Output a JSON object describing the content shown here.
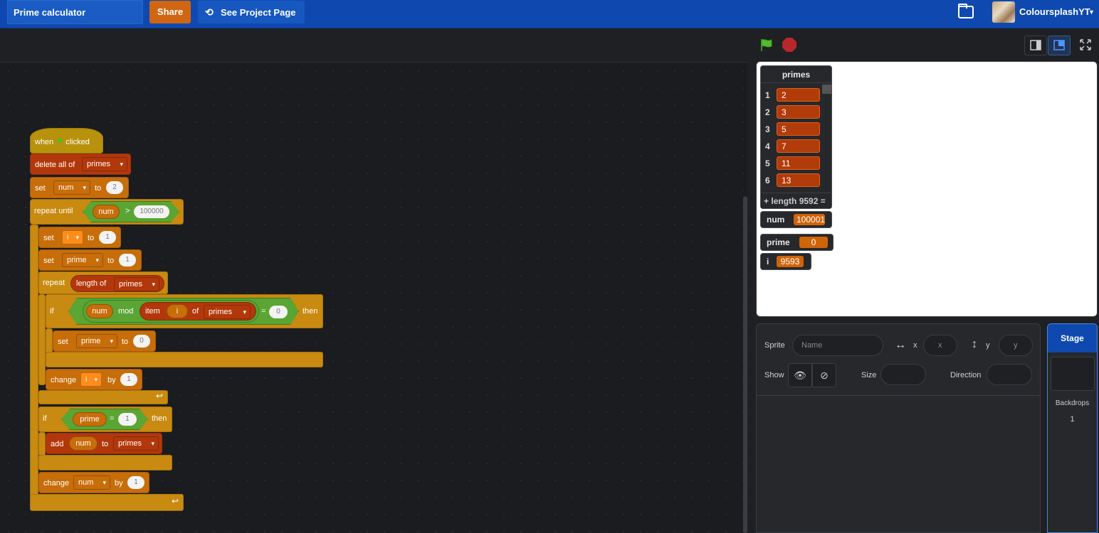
{
  "menubar": {
    "project_title": "Prime calculator",
    "share_label": "Share",
    "project_page_label": "See Project Page",
    "username": "ColoursplashYT"
  },
  "stage": {
    "list": {
      "title": "primes",
      "items": [
        {
          "index": "1",
          "value": "2"
        },
        {
          "index": "2",
          "value": "3"
        },
        {
          "index": "3",
          "value": "5"
        },
        {
          "index": "4",
          "value": "7"
        },
        {
          "index": "5",
          "value": "11"
        },
        {
          "index": "6",
          "value": "13"
        }
      ],
      "footer_plus": "+",
      "footer_length": "length 9592",
      "footer_eq": "="
    },
    "variables": {
      "num": {
        "label": "num",
        "value": "100001"
      },
      "prime": {
        "label": "prime",
        "value": "0"
      },
      "i": {
        "label": "i",
        "value": "9593"
      }
    }
  },
  "sprite_info": {
    "sprite_label": "Sprite",
    "name_placeholder": "Name",
    "x_label": "x",
    "x_placeholder": "x",
    "y_label": "y",
    "y_placeholder": "y",
    "show_label": "Show",
    "size_label": "Size",
    "direction_label": "Direction"
  },
  "stage_panel": {
    "tab_label": "Stage",
    "backdrops_label": "Backdrops",
    "backdrops_count": "1"
  },
  "script": {
    "when": "when",
    "clicked": "clicked",
    "delete_all_of": "delete all of",
    "primes": "primes",
    "set": "set",
    "to": "to",
    "num": "num",
    "i": "i",
    "prime": "prime",
    "v2": "2",
    "v1": "1",
    "v0": "0",
    "v100000": "100000",
    "gt": ">",
    "eq": "=",
    "repeat_until": "repeat until",
    "repeat": "repeat",
    "length_of": "length of",
    "if": "if",
    "then": "then",
    "mod": "mod",
    "item": "item",
    "of": "of",
    "change": "change",
    "by": "by",
    "add": "add"
  },
  "colors": {
    "menubar": "#0f49b0",
    "share": "#d06612",
    "events": "#b8920d",
    "variables": "#c76d0a",
    "control": "#c88a10",
    "lists": "#b2380b",
    "operators": "#489329"
  }
}
